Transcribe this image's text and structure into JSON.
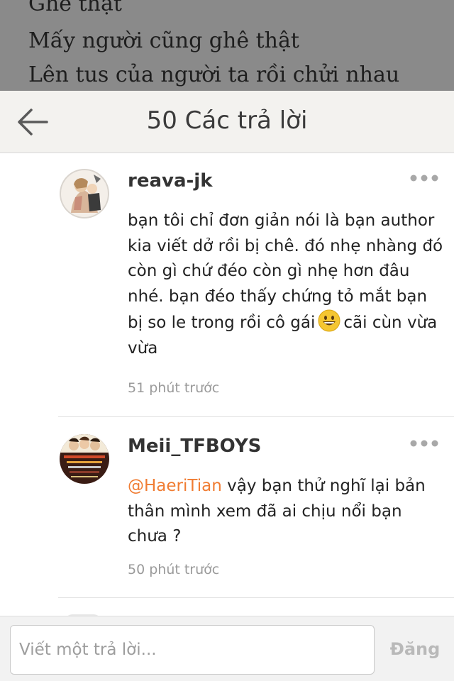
{
  "backdrop": {
    "lines": [
      "Ghê thật",
      "Mấy người cũng ghê thật",
      "Lên tus của người ta rồi chửi nhau"
    ]
  },
  "header": {
    "back_icon": "arrow-left-icon",
    "title": "50 Các trả lời"
  },
  "comments": [
    {
      "username": "reava-jk",
      "body_before_emoji": "bạn tôi chỉ đơn giản nói là bạn author kia viết dở rồi bị chê. đó nhẹ nhàng đó còn gì chứ đéo còn gì nhẹ hơn đâu nhé. bạn đéo thấy chứng tỏ mắt bạn bị so le trong rồi cô gái",
      "emoji": "grinning-face-emoji",
      "body_after_emoji": "cãi cùn vừa vừa",
      "timestamp": "51 phút trước",
      "more_icon": "more-dots-icon"
    },
    {
      "username": "Meii_TFBOYS",
      "mention": "@HaeriTian",
      "body": "vậy bạn thử nghĩ lại bản thân mình xem đã ai chịu nổi bạn chưa ?",
      "timestamp": "50 phút trước",
      "more_icon": "more-dots-icon"
    }
  ],
  "reply_bar": {
    "placeholder": "Viết một trả lời...",
    "post_label": "Đăng"
  },
  "colors": {
    "mention": "#f07c32",
    "header_bg": "#f3f2ef",
    "timestamp": "#9a9a9a",
    "disabled_button": "#b9b9b9"
  }
}
